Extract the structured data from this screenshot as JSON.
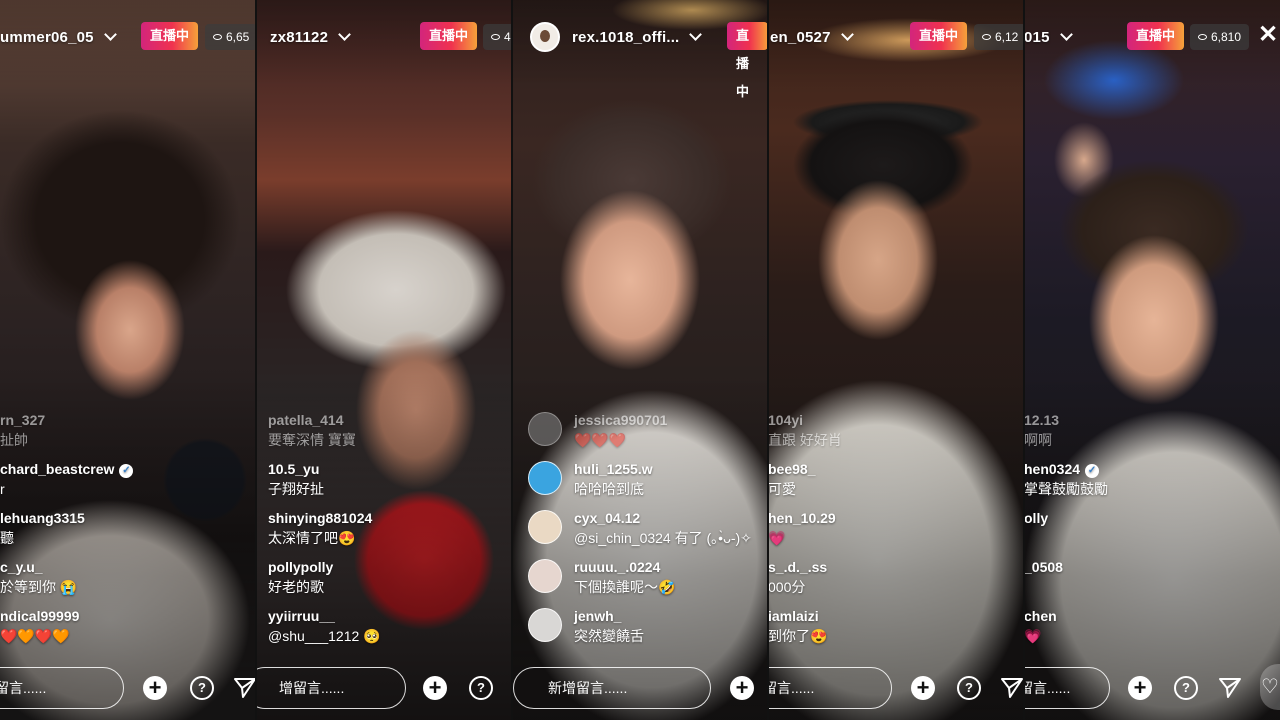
{
  "ui": {
    "live_label": "直播中",
    "comment_placeholder": "新增留言......",
    "close_glyph": "✕",
    "heart_glyph": "♡",
    "colors": {
      "live_gradient_start": "#d3257c",
      "live_gradient_end": "#f6a13a",
      "viewer_badge": "#3c3c3c"
    }
  },
  "panels": [
    {
      "username": "ummer06_05",
      "viewers": "6,65",
      "input_text": "留言......",
      "comments": [
        {
          "user": "rn_327",
          "text": "扯帥",
          "faded": true
        },
        {
          "user": "chard_beastcrew",
          "text": "r",
          "verified": true
        },
        {
          "user": "lehuang3315",
          "text": "聽"
        },
        {
          "user": "c_y.u_",
          "text": "於等到你 😭"
        },
        {
          "user": "ndical99999",
          "text": "❤️🧡❤️🧡"
        }
      ]
    },
    {
      "username": "zx81122",
      "viewers": "4",
      "input_text": "增留言......",
      "comments": [
        {
          "user": "patella_414",
          "text": "要奪深情 寶寶",
          "faded": true
        },
        {
          "user": "10.5_yu",
          "text": "子翔好扯"
        },
        {
          "user": "shinying881024",
          "text": "太深情了吧😍"
        },
        {
          "user": "pollypolly",
          "text": "好老的歌"
        },
        {
          "user": "yyiirruu__",
          "text": "@shu___1212 🥺"
        }
      ]
    },
    {
      "username": "rex.1018_offi...",
      "viewers": "",
      "input_text": "新增留言......",
      "comments": [
        {
          "user": "jessica990701",
          "text": "❤️❤️❤️",
          "faded": true
        },
        {
          "user": "huli_1255.w",
          "text": "哈哈哈到底"
        },
        {
          "user": "cyx_04.12",
          "text": "@si_chin_0324 有了 (｡•̀ᴗ-)✧"
        },
        {
          "user": "ruuuu._.0224",
          "text": "下個換誰呢～🤣"
        },
        {
          "user": "jenwh_",
          "text": "突然變饒舌"
        }
      ]
    },
    {
      "username": "en_0527",
      "viewers": "6,12",
      "input_text": "留言......",
      "comments": [
        {
          "user": "104yi",
          "text": "直跟 好好肖",
          "faded": true
        },
        {
          "user": "bee98_",
          "text": "可愛"
        },
        {
          "user": "hen_10.29",
          "text": "💗"
        },
        {
          "user": "s_.d._.ss",
          "text": "000分"
        },
        {
          "user": "iamlaizi",
          "text": "到你了😍"
        }
      ]
    },
    {
      "username": "015",
      "viewers": "6,810",
      "input_text": "留言......",
      "comments": [
        {
          "user": "12.13",
          "text": "啊啊",
          "faded": true
        },
        {
          "user": "hen0324",
          "text": "掌聲鼓勵鼓勵",
          "verified": true
        },
        {
          "user": "olly",
          "text": ""
        },
        {
          "user": "_0508",
          "text": ""
        },
        {
          "user": "chen",
          "text": "💗"
        }
      ]
    }
  ]
}
